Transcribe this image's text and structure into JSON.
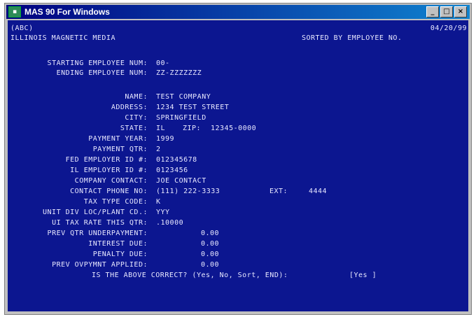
{
  "window": {
    "title": "MAS 90 For Windows",
    "controls": [
      "_",
      "□",
      "×"
    ]
  },
  "header": {
    "company_code": "(ABC)",
    "date": "04/20/99",
    "report_name": "ILLINOIS MAGNETIC MEDIA",
    "sort_info": "SORTED BY EMPLOYEE NO."
  },
  "range": {
    "start_label": "STARTING EMPLOYEE NUM:",
    "start_value": "00-",
    "end_label": "ENDING EMPLOYEE NUM:",
    "end_value": "ZZ-ZZZZZZZ"
  },
  "fields": {
    "name_label": "NAME:",
    "name_value": "TEST COMPANY",
    "address_label": "ADDRESS:",
    "address_value": "1234 TEST STREET",
    "city_label": "CITY:",
    "city_value": "SPRINGFIELD",
    "state_label": "STATE:",
    "state_value": "IL",
    "zip_label": "ZIP:",
    "zip_value": "12345-0000",
    "year_label": "PAYMENT YEAR:",
    "year_value": "1999",
    "qtr_label": "PAYMENT QTR:",
    "qtr_value": "2",
    "fed_label": "FED EMPLOYER ID #:",
    "fed_value": "012345678",
    "il_label": "IL EMPLOYER ID #:",
    "il_value": "0123456",
    "contact_label": "COMPANY CONTACT:",
    "contact_value": "JOE CONTACT",
    "phone_label": "CONTACT PHONE NO:",
    "phone_value": "(111) 222-3333",
    "ext_label": "EXT:",
    "ext_value": "4444",
    "tax_label": "TAX TYPE CODE:",
    "tax_value": "K",
    "unit_label": "UNIT DIV LOC/PLANT CD.:",
    "unit_value": "YYY",
    "rate_label": "UI TAX RATE THIS QTR:",
    "rate_value": ".10000",
    "prev_label": "PREV QTR UNDERPAYMENT:",
    "prev_value": "0.00",
    "interest_label": "INTEREST DUE:",
    "interest_value": "0.00",
    "penalty_label": "PENALTY DUE:",
    "penalty_value": "0.00",
    "overpay_label": "PREV OVPYMNT APPLIED:",
    "overpay_value": "0.00"
  },
  "prompt": {
    "question": "IS THE ABOVE CORRECT? (Yes, No, Sort, END):",
    "answer": "[Yes ]"
  },
  "colors": {
    "screen_bg": "#0c1690",
    "screen_text": "#e8e8ff",
    "titlebar": "#000080"
  }
}
